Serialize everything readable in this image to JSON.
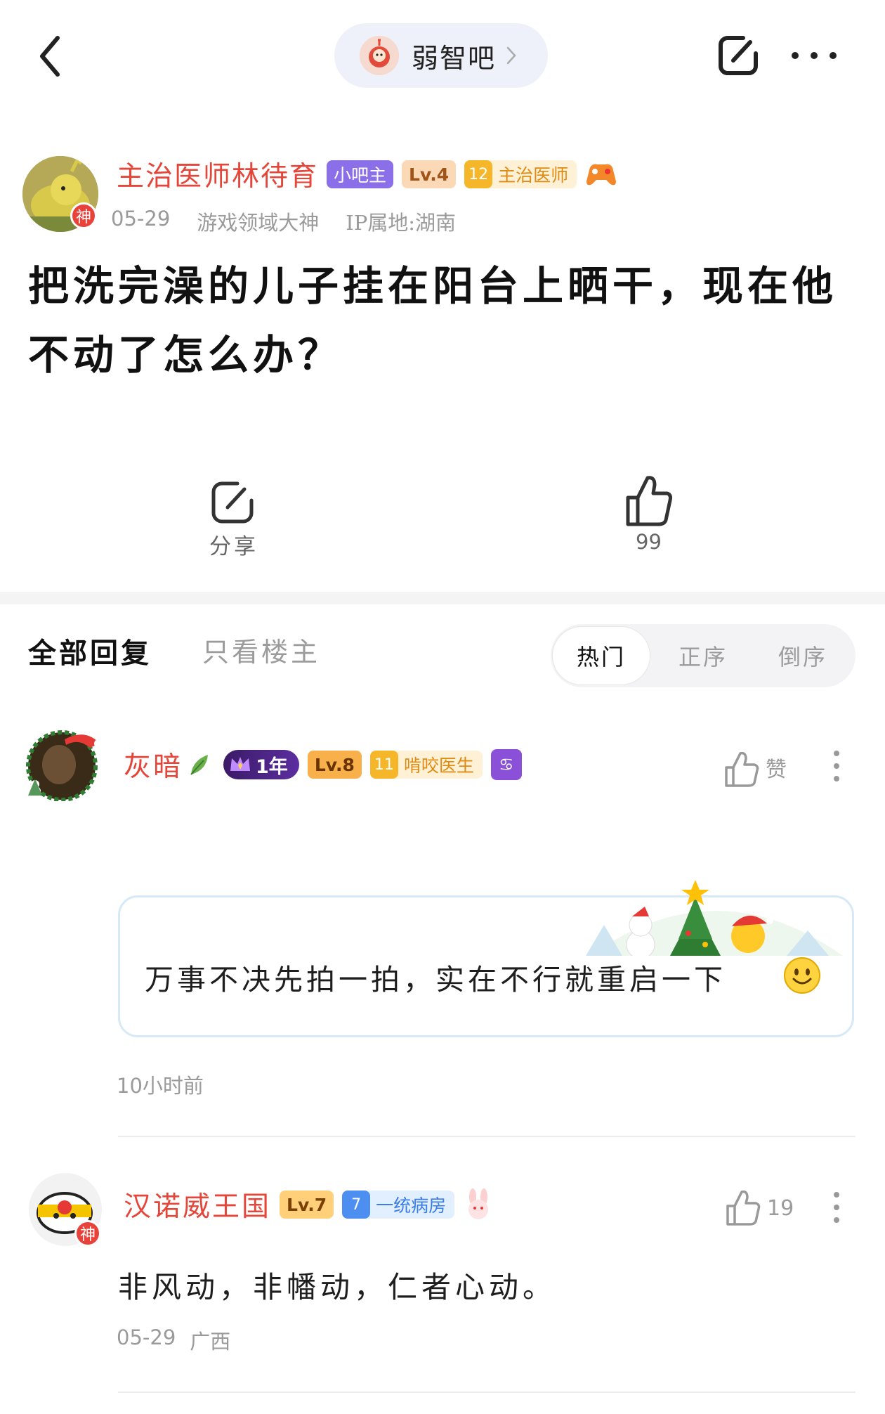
{
  "header": {
    "forum_name": "弱智吧",
    "back_icon": "chevron-left-icon",
    "edit_icon": "edit-square-icon",
    "more_icon": "more-dots-icon"
  },
  "post": {
    "author": {
      "name": "主治医师林待育",
      "god_badge": "神",
      "badges": {
        "owner": "小吧主",
        "level": "Lv.4",
        "title_level": "12",
        "title": "主治医师"
      }
    },
    "meta": {
      "date": "05-29",
      "tag": "游戏领域大神",
      "ip": "IP属地:湖南"
    },
    "title": "把洗完澡的儿子挂在阳台上晒干，现在他不动了怎么办？",
    "actions": {
      "share_label": "分享",
      "like_count": "99"
    }
  },
  "replies": {
    "tabs": {
      "all": "全部回复",
      "op_only": "只看楼主"
    },
    "sort": {
      "hot": "热门",
      "asc": "正序",
      "desc": "倒序"
    },
    "items": [
      {
        "name": "灰暗",
        "year_badge": "1年",
        "level": "Lv.8",
        "title_level": "11",
        "title": "啃咬医生",
        "zodiac_icon": "cancer-zodiac-icon",
        "like_label": "赞",
        "text": "万事不决先拍一拍，实在不行就重启一下",
        "time": "10小时前"
      },
      {
        "name": "汉诺威王国",
        "god_badge": "神",
        "level": "Lv.7",
        "title_level": "7",
        "title": "一统病房",
        "like_count": "19",
        "text": "非风动，非幡动，仁者心动。",
        "date": "05-29",
        "location": "广西"
      }
    ]
  },
  "colors": {
    "name_red": "#e5463a",
    "owner_purple": "#8b6fe8",
    "muted_gray": "#9a9a9a",
    "bubble_border": "#d6e9f7"
  }
}
